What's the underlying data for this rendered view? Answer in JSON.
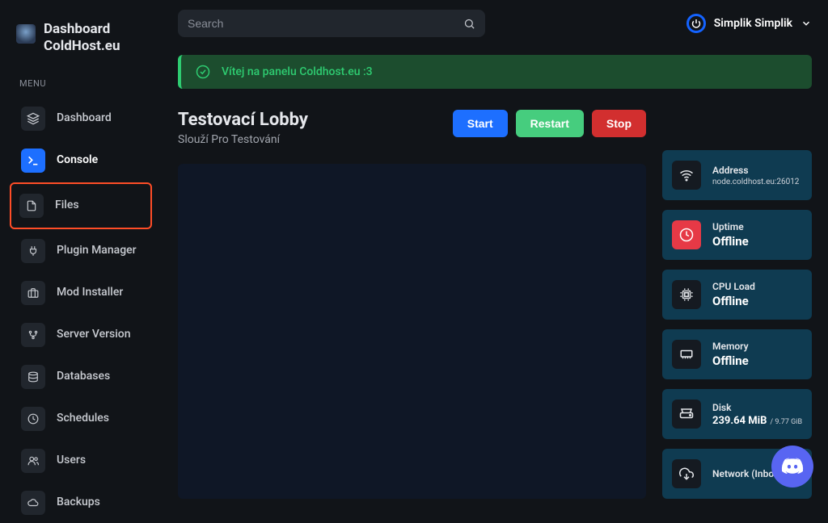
{
  "brand": {
    "title": "Dashboard",
    "subtitle": "ColdHost.eu"
  },
  "menu": {
    "heading": "MENU",
    "items": [
      {
        "label": "Dashboard"
      },
      {
        "label": "Console"
      },
      {
        "label": "Files"
      },
      {
        "label": "Plugin Manager"
      },
      {
        "label": "Mod Installer"
      },
      {
        "label": "Server Version"
      },
      {
        "label": "Databases"
      },
      {
        "label": "Schedules"
      },
      {
        "label": "Users"
      },
      {
        "label": "Backups"
      }
    ]
  },
  "search": {
    "placeholder": "Search"
  },
  "user": {
    "name": "Simplik Simplik"
  },
  "banner": {
    "text": "Vítej na panelu Coldhost.eu :3"
  },
  "page": {
    "title": "Testovací Lobby",
    "subtitle": "Slouží Pro Testování"
  },
  "actions": {
    "start": "Start",
    "restart": "Restart",
    "stop": "Stop"
  },
  "stats": {
    "address": {
      "label": "Address",
      "value": "node.coldhost.eu:26012"
    },
    "uptime": {
      "label": "Uptime",
      "value": "Offline"
    },
    "cpu": {
      "label": "CPU Load",
      "value": "Offline"
    },
    "memory": {
      "label": "Memory",
      "value": "Offline"
    },
    "disk": {
      "label": "Disk",
      "value": "239.64 MiB",
      "max": "/ 9.77 GiB"
    },
    "network": {
      "label": "Network (Inbound)"
    }
  }
}
